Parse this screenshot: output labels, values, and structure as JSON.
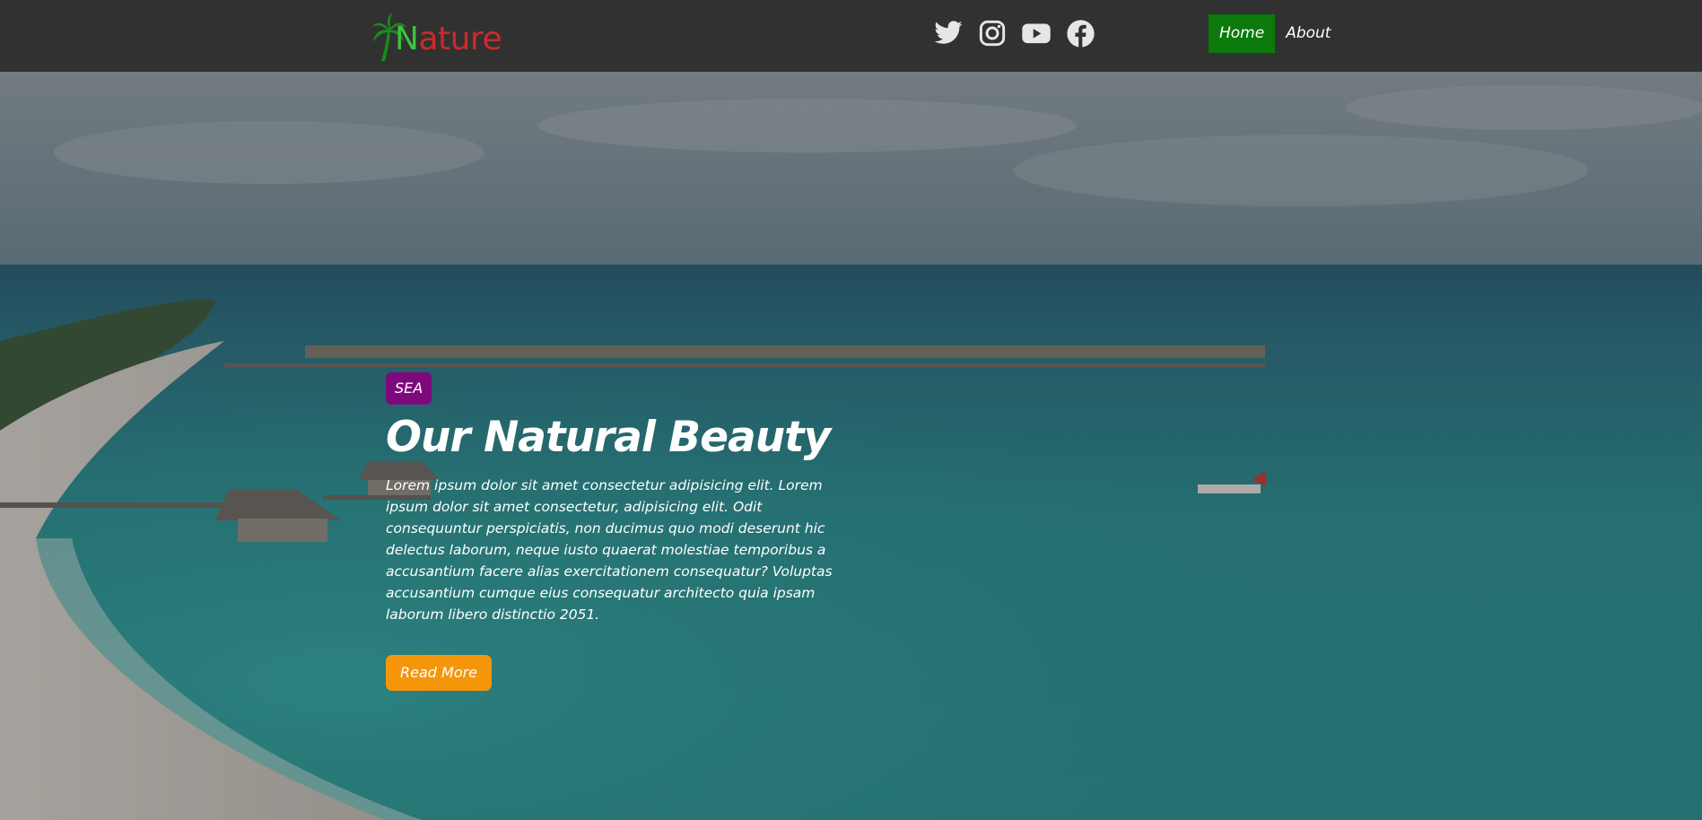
{
  "brand": {
    "name_first_letter": "N",
    "name_rest": "ature",
    "colors": {
      "leaf": "#1c8a1c",
      "first_letter": "#3fc23f",
      "rest": "#cc2a2a"
    }
  },
  "socials": [
    {
      "icon": "twitter-icon"
    },
    {
      "icon": "instagram-icon"
    },
    {
      "icon": "youtube-icon"
    },
    {
      "icon": "facebook-icon"
    }
  ],
  "nav": {
    "items": [
      {
        "label": "Home",
        "active": true
      },
      {
        "label": "About",
        "active": false
      }
    ],
    "active_color": "#0b7a0b",
    "background": "#313131"
  },
  "hero": {
    "badge": "SEA",
    "badge_color": "#7d0a7d",
    "title": "Our Natural Beauty",
    "text": "Lorem ipsum dolor sit amet consectetur adipisicing elit. Lorem ipsum dolor sit amet consectetur, adipisicing elit. Odit consequuntur perspiciatis, non ducimus quo modi deserunt hic delectus laborum, neque iusto quaerat molestiae temporibus a accusantium facere alias exercitationem consequatur? Voluptas accusantium cumque eius consequatur architecto quia ipsam laborum libero distinctio 2051.",
    "button": "Read More",
    "button_color": "#f5960a"
  }
}
